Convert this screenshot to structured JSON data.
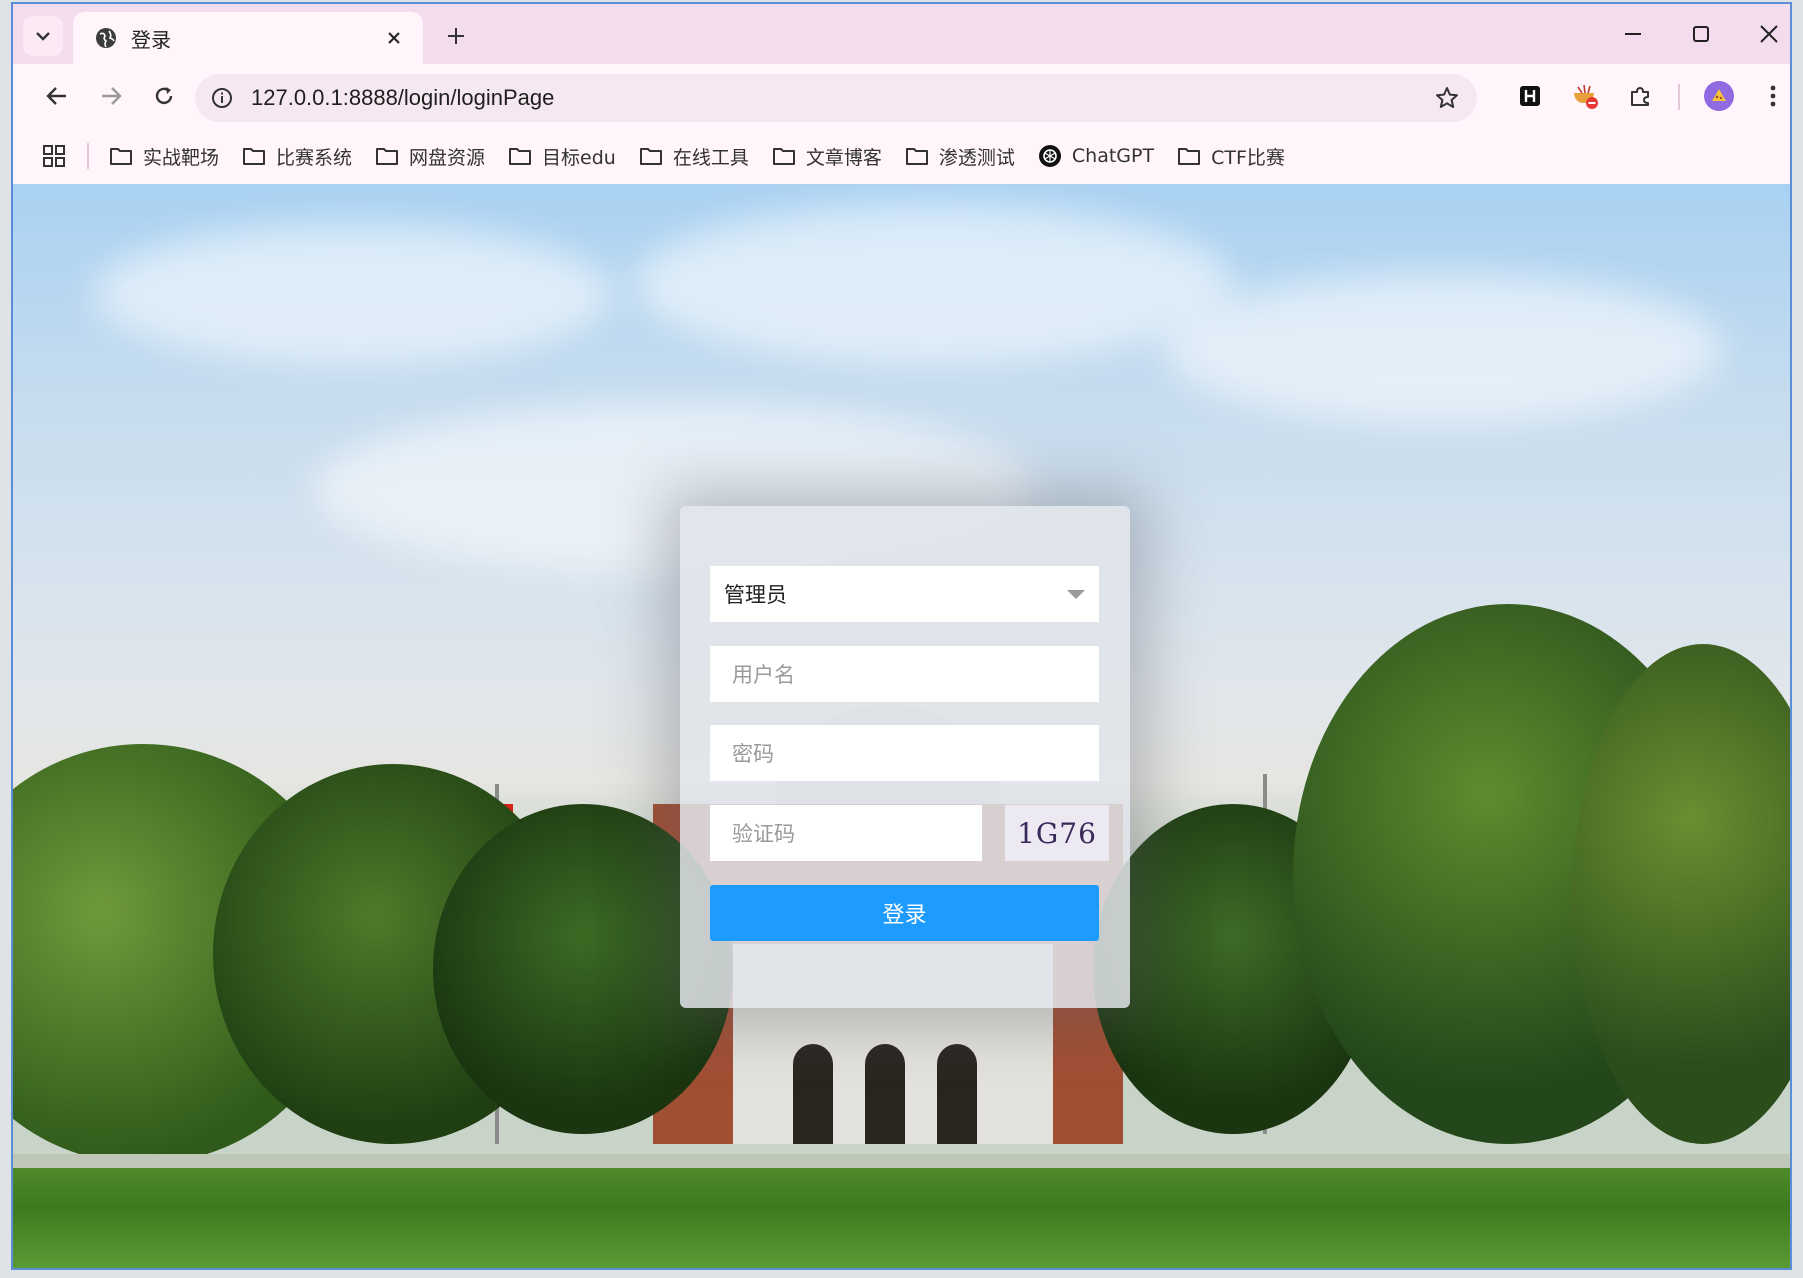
{
  "browser": {
    "tab_title": "登录",
    "url": "127.0.0.1:8888/login/loginPage",
    "bookmarks": [
      "实战靶场",
      "比赛系统",
      "网盘资源",
      "目标edu",
      "在线工具",
      "文章博客",
      "渗透测试",
      "ChatGPT",
      "CTF比赛"
    ]
  },
  "login": {
    "role_selected": "管理员",
    "username_placeholder": "用户名",
    "password_placeholder": "密码",
    "captcha_placeholder": "验证码",
    "captcha_code": "1G76",
    "login_button": "登录"
  },
  "colors": {
    "tabstrip": "#f3dced",
    "toolbar": "#fff5fb",
    "login_button": "#1e9bff",
    "window_border": "#5a8ed8"
  },
  "icons": [
    "tab-search-icon",
    "globe-icon",
    "close-icon",
    "plus-icon",
    "minimize-icon",
    "maximize-icon",
    "back-icon",
    "forward-icon",
    "reload-icon",
    "info-icon",
    "star-icon",
    "extension-h-icon",
    "extension-noodle-icon",
    "puzzle-icon",
    "avatar",
    "more-icon",
    "apps-grid-icon",
    "folder-icon",
    "openai-icon"
  ]
}
